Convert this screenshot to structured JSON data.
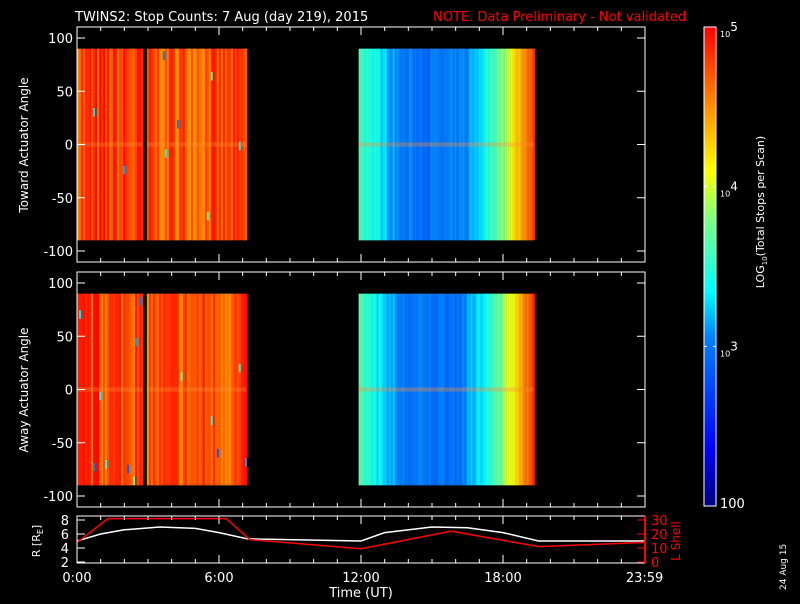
{
  "chart_data": [
    {
      "type": "heatmap",
      "title": "TWINS2: Stop Counts:  7 Aug (day 219), 2015",
      "note": "NOTE. Data Preliminary - Not validated",
      "ylabel": "Toward Actuator Angle",
      "ylim": [
        -100,
        100
      ],
      "yticks": [
        "100",
        "50",
        "0",
        "-50",
        "-100"
      ],
      "xlim_hours": [
        0,
        24
      ],
      "data_intervals_hours": [
        [
          0.0,
          2.75
        ],
        [
          2.95,
          7.15
        ],
        [
          11.9,
          19.3
        ]
      ],
      "interval_levels_log10": [
        4.75,
        4.7,
        3.6
      ]
    },
    {
      "type": "heatmap",
      "ylabel": "Away Actuator Angle",
      "ylim": [
        -100,
        100
      ],
      "yticks": [
        "100",
        "50",
        "0",
        "-50",
        "-100"
      ],
      "xlim_hours": [
        0,
        24
      ],
      "data_intervals_hours": [
        [
          0.0,
          2.75
        ],
        [
          2.95,
          7.15
        ],
        [
          11.9,
          19.3
        ]
      ],
      "interval_levels_log10": [
        4.75,
        4.7,
        3.6
      ]
    },
    {
      "type": "line",
      "ylabel": "R [R",
      "ylabel_sub": "E",
      "ylabel_close": "]",
      "y2label": "L Shell",
      "ylim": [
        2,
        8
      ],
      "y2lim": [
        0,
        30
      ],
      "yticks": [
        "8",
        "6",
        "4",
        "2"
      ],
      "y2ticks": [
        "30",
        "20",
        "10",
        "0"
      ],
      "xlabel": "Time (UT)",
      "xticks": [
        "0:00",
        "6:00",
        "12:00",
        "18:00",
        "23:59"
      ],
      "series": [
        {
          "name": "R",
          "color": "#ffffff",
          "x": [
            0,
            1,
            2,
            3.5,
            5,
            6,
            7.2,
            12,
            13,
            15,
            16.5,
            18,
            19.5,
            24
          ],
          "y": [
            5,
            6,
            6.6,
            7,
            6.8,
            6.2,
            5.3,
            5,
            6.2,
            7,
            6.9,
            6.2,
            5,
            5
          ]
        },
        {
          "name": "L Shell",
          "color": "#ff0000",
          "axis": "right",
          "x": [
            0,
            1.3,
            6.3,
            7.3,
            12,
            15.8,
            19.5,
            24
          ],
          "y": [
            14,
            31,
            31,
            16,
            9.5,
            22,
            11,
            14
          ]
        }
      ]
    }
  ],
  "colorbar": {
    "label": "LOG",
    "label_sub": "10",
    "label_rest": "(Total Stops per Scan)",
    "ticks": [
      {
        "base": "10",
        "exp": "5",
        "value": 5
      },
      {
        "base": "10",
        "exp": "4",
        "value": 4
      },
      {
        "base": "10",
        "exp": "3",
        "value": 3
      },
      {
        "base": "100",
        "exp": "",
        "value": 2
      }
    ],
    "range_log10": [
      2,
      5
    ]
  },
  "footer_date": "24 Aug 15"
}
